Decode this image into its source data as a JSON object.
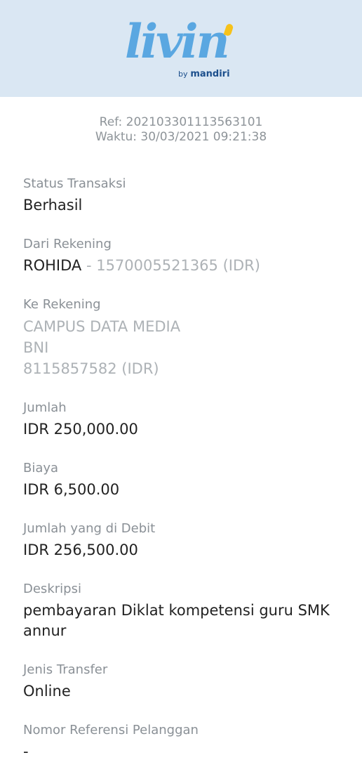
{
  "brand": {
    "logo_text": "livin",
    "by_label": "by",
    "bank_label": "mandiri"
  },
  "meta": {
    "ref": "Ref: 202103301113563101",
    "time": "Waktu: 30/03/2021 09:21:38"
  },
  "fields": {
    "status": {
      "label": "Status Transaksi",
      "value": "Berhasil"
    },
    "from": {
      "label": "Dari Rekening",
      "name": "ROHIDA",
      "account": " - 1570005521365 (IDR)"
    },
    "to": {
      "label": "Ke Rekening",
      "name": "CAMPUS DATA MEDIA",
      "bank": "BNI",
      "account": "8115857582 (IDR)"
    },
    "amount": {
      "label": "Jumlah",
      "value": "IDR 250,000.00"
    },
    "fee": {
      "label": "Biaya",
      "value": "IDR 6,500.00"
    },
    "debit": {
      "label": "Jumlah yang di Debit",
      "value": "IDR 256,500.00"
    },
    "description": {
      "label": "Deskripsi",
      "value": "pembayaran Diklat kompetensi guru SMK annur"
    },
    "transfer_type": {
      "label": "Jenis Transfer",
      "value": "Online"
    },
    "customer_ref": {
      "label": "Nomor Referensi Pelanggan",
      "value": "-"
    }
  },
  "colors": {
    "header_bg": "#dae7f3",
    "logo_blue": "#5aa7e1",
    "logo_accent": "#f6c21a",
    "brand_navy": "#1c4f8c"
  }
}
